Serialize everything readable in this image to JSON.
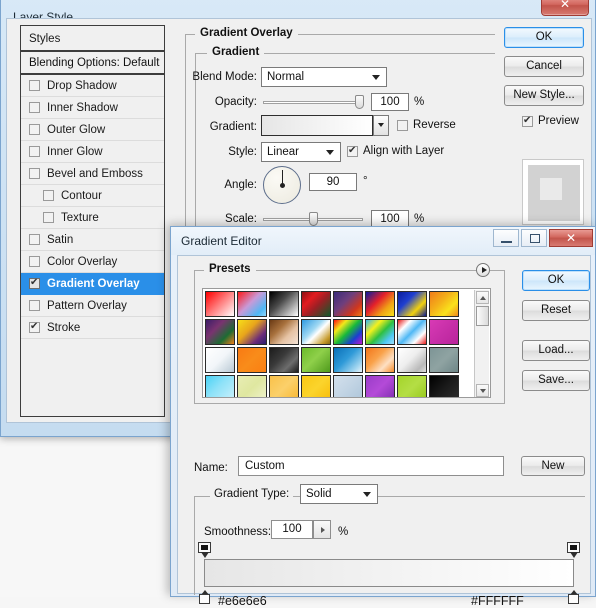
{
  "layer_style": {
    "title": "Layer Style",
    "close_label": "✕",
    "styles_panel": {
      "header": "Styles",
      "blending_options": "Blending Options: Default",
      "items": [
        {
          "label": "Drop Shadow",
          "checked": false,
          "sub": false
        },
        {
          "label": "Inner Shadow",
          "checked": false,
          "sub": false
        },
        {
          "label": "Outer Glow",
          "checked": false,
          "sub": false
        },
        {
          "label": "Inner Glow",
          "checked": false,
          "sub": false
        },
        {
          "label": "Bevel and Emboss",
          "checked": false,
          "sub": false
        },
        {
          "label": "Contour",
          "checked": false,
          "sub": true
        },
        {
          "label": "Texture",
          "checked": false,
          "sub": true
        },
        {
          "label": "Satin",
          "checked": false,
          "sub": false
        },
        {
          "label": "Color Overlay",
          "checked": false,
          "sub": false
        },
        {
          "label": "Gradient Overlay",
          "checked": true,
          "sub": false,
          "selected": true
        },
        {
          "label": "Pattern Overlay",
          "checked": false,
          "sub": false
        },
        {
          "label": "Stroke",
          "checked": true,
          "sub": false
        }
      ]
    },
    "gradient_overlay": {
      "section_title": "Gradient Overlay",
      "group_title": "Gradient",
      "blend_mode_label": "Blend Mode:",
      "blend_mode_value": "Normal",
      "opacity_label": "Opacity:",
      "opacity_value": "100",
      "opacity_unit": "%",
      "gradient_label": "Gradient:",
      "reverse_label": "Reverse",
      "reverse_checked": false,
      "style_label": "Style:",
      "style_value": "Linear",
      "align_label": "Align with Layer",
      "align_checked": true,
      "angle_label": "Angle:",
      "angle_value": "90",
      "angle_unit": "°",
      "scale_label": "Scale:",
      "scale_value": "100",
      "scale_unit": "%",
      "gradient_preview_from": "#e6e6e6",
      "gradient_preview_to": "#ffffff"
    },
    "buttons": {
      "ok": "OK",
      "cancel": "Cancel",
      "new_style": "New Style...",
      "preview_label": "Preview",
      "preview_checked": true
    }
  },
  "gradient_editor": {
    "title": "Gradient Editor",
    "window_buttons": {
      "minimize": "minimize-icon",
      "maximize": "maximize-icon",
      "close": "✕"
    },
    "presets": {
      "title": "Presets",
      "expand_icon": "play-arrow-icon",
      "swatches": [
        "linear-gradient(135deg,#ff0000,#ffffff)",
        "linear-gradient(135deg,#ff1a1a 0%,#c89ad8 45%,#4fb8f5 80%,#8fd6fb 100%)",
        "linear-gradient(135deg,#000000,#4a4a4a 40%,#ffffff)",
        "linear-gradient(135deg,#8f1013 0%,#e21b20 30%,#9d1f24 55%,#0f5a2a 100%)",
        "linear-gradient(135deg,#3a2c7a 0%,#6e3f7d 40%,#d0371d 75%,#f07c1a 100%)",
        "linear-gradient(135deg,#0d1b9e 0%,#e4202a 40%,#f0a016 70%,#f7e31b 100%)",
        "linear-gradient(135deg,#0b1c9c 0%,#1f3fd0 35%,#f2d20d 70%,#0d1a8f 100%)",
        "linear-gradient(135deg,#f07c1a 0%,#f4b019 40%,#f9e21c 70%,#f08a1e 100%)",
        "linear-gradient(135deg,#3d1e68 0%,#7a3370 35%,#1d6b33 70%,#ef7f1b 100%)",
        "linear-gradient(135deg,#f7de1a 0%,#e8a51b 40%,#6b2b7a 75%,#2a1d6e 100%)",
        "linear-gradient(135deg,#6a3a14 0%,#a8713d 35%,#e6c3a4 65%,#f4e3d6 100%)",
        "linear-gradient(135deg,#2f9ae0 0%,#9fd8f3 40%,#ffffff 55%,#c69a2a 85%,#8a6a12 100%)",
        "linear-gradient(135deg,#ff1010 0%,#f3e81a 25%,#18b93a 50%,#1a3fd0 75%,#c01ad0 100%)",
        "linear-gradient(135deg,#35b6f0 0%,#f5f11c 30%,#2fc040 55%,#4fc8f5 80%,#9fe0fb 100%)",
        "linear-gradient(135deg,#e81a1a 0%,#ffffff 25%,#4fb8f5 50%,#ffffff 75%,#e81a1a 100%)",
        "linear-gradient(135deg,#d83ab5 0%,#c72fa8 50%,#b9249b 100%)",
        "linear-gradient(135deg,#ffffff 0%,#f2f6f9 50%,#b9c9d4 100%)",
        "linear-gradient(135deg,#f97a13 0%,#f98c1a 50%,#fa7e12 100%)",
        "linear-gradient(135deg,#1c1c1c 0%,#3a3a3a 40%,#6d6d6d 70%,#1d1d1d 100%)",
        "linear-gradient(135deg,#6bbb2a 0%,#8fd04a 45%,#4f9a1c 100%)",
        "linear-gradient(135deg,#0a6fb8 0%,#2f9ad8 45%,#9fd4ef 80%,#e8f4fb 100%)",
        "linear-gradient(135deg,#f2751a 0%,#f9a24a 40%,#fde0c4 70%,#f68b28 100%)",
        "linear-gradient(135deg,#ffffff 0%,#eeeeee 45%,#b9b9b9 80%,#dedede 100%)",
        "linear-gradient(135deg,#7d9596 0%,#8fa3a2 50%,#6e8687 100%)",
        "linear-gradient(135deg,#49d2f5 0%,#8fe2f8 45%,#c9f0fb 100%)",
        "linear-gradient(135deg,#e8edb4 0%,#dfe7a0 50%,#eef2cb 100%)",
        "linear-gradient(135deg,#f9c14a 0%,#fbd06a 50%,#f8b833 100%)",
        "linear-gradient(135deg,#f9c714 0%,#fbd42c 50%,#f8bd0a 100%)",
        "linear-gradient(135deg,#d3e0ec 0%,#c2d4e4 50%,#aec6da 100%)",
        "linear-gradient(135deg,#9a3cc8 0%,#b44ad8 50%,#7f2fb0 100%)",
        "linear-gradient(135deg,#a4d42a 0%,#b4de45 50%,#96c91c 100%)",
        "linear-gradient(135deg,#000000 0%,#1a1a1a 50%,#2e2e2e 100%)"
      ]
    },
    "name_label": "Name:",
    "name_value": "Custom",
    "new_button": "New",
    "gradient_type_label": "Gradient Type:",
    "gradient_type_value": "Solid",
    "smoothness_label": "Smoothness:",
    "smoothness_value": "100",
    "smoothness_unit": "%",
    "gradient_strip": {
      "from": "#e6e6e6",
      "to": "#FFFFFF",
      "left_stop_hex": "#e6e6e6",
      "right_stop_hex": "#FFFFFF"
    },
    "buttons": {
      "ok": "OK",
      "reset": "Reset",
      "load": "Load...",
      "save": "Save..."
    }
  }
}
